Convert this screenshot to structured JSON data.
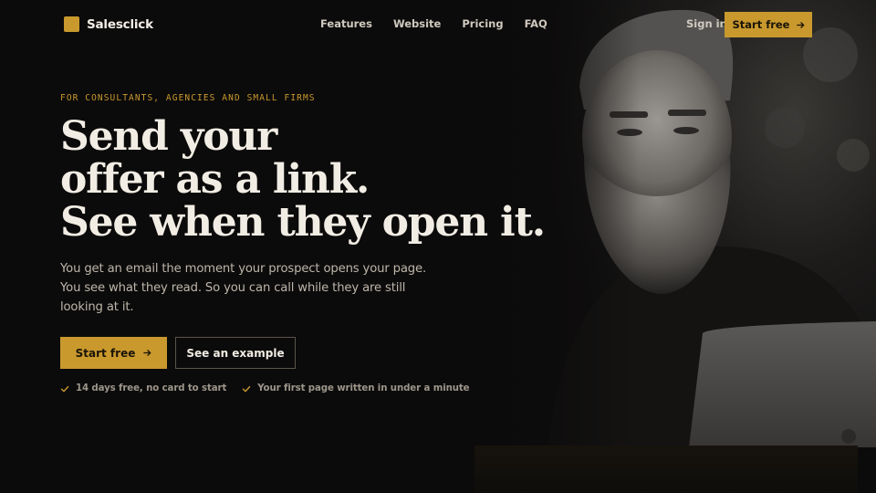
{
  "brand": {
    "name": "Salesclick",
    "accent": "#c9992e"
  },
  "nav": {
    "links": [
      "Features",
      "Website",
      "Pricing",
      "FAQ"
    ],
    "signin": "Sign in",
    "cta": "Start free"
  },
  "hero": {
    "eyebrow": "FOR CONSULTANTS, AGENCIES AND SMALL FIRMS",
    "headline": [
      "Send your",
      "offer as a link.",
      "See when they open it."
    ],
    "subcopy": "You get an email the moment your prospect opens your page. You see what they read. So you can call while they are still looking at it.",
    "primary_cta": "Start free",
    "secondary_cta": "See an example",
    "checks": [
      "14 days free, no card to start",
      "Your first page written in under a minute"
    ]
  },
  "icons": {
    "arrow": "arrow-right-icon",
    "check": "check-icon",
    "logo": "logo-mark-icon"
  }
}
